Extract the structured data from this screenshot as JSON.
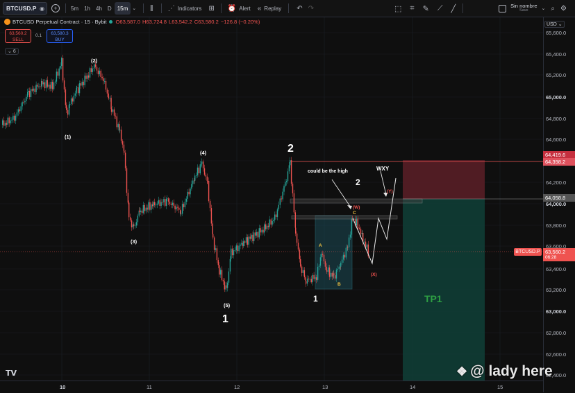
{
  "toolbar": {
    "symbol": "BTCUSD.P",
    "intervals": [
      "5m",
      "1h",
      "4h",
      "D",
      "15m"
    ],
    "active_interval": "15m",
    "indicators_label": "Indicators",
    "alert_label": "Alert",
    "replay_label": "Replay",
    "layout_name": "Sin nombre",
    "layout_status": "Save"
  },
  "legend": {
    "title": "BTCUSD Perpetual Contract · 15 · Bybit",
    "open": "O63,587.0",
    "high": "H63,724.8",
    "low": "L63,542.2",
    "close": "C63,580.2",
    "change": "−126.8 (−0.20%)"
  },
  "trade": {
    "sell_price": "63,560.2",
    "sell_label": "SELL",
    "spread": "0.1",
    "buy_price": "63,580.3",
    "buy_label": "BUY",
    "indicators_count": "6"
  },
  "price_axis": {
    "currency": "USD",
    "labels": [
      "65,600.0",
      "65,400.0",
      "65,200.0",
      "65,000.0",
      "64,800.0",
      "64,600.0",
      "64,200.0",
      "64,000.0",
      "63,800.0",
      "63,600.0",
      "63,400.0",
      "63,200.0",
      "63,000.0",
      "62,800.0",
      "62,600.0",
      "62,400.0"
    ],
    "tag_top": "64,419.6",
    "tag_top2": "64,398.2",
    "tag_mid": "64,058.8",
    "tag_symbol": "BTCUSD.P",
    "tag_last": "63,560.2",
    "tag_countdown": "06:28"
  },
  "time_axis": {
    "labels": [
      "10",
      "11",
      "12",
      "13",
      "14",
      "15"
    ]
  },
  "annotations": {
    "w1": "(1)",
    "w2": "(2)",
    "w3": "(3)",
    "w4": "(4)",
    "w5": "(5)",
    "big1": "1",
    "big2": "2",
    "big2b": "2",
    "big1b": "1",
    "note": "could be the high",
    "wxy": "WXY",
    "W": "(W)",
    "X": "(X)",
    "Y": "(Y)",
    "A": "A",
    "B": "B",
    "C": "C",
    "tp1": "TP1"
  },
  "watermark": "@ lady here",
  "colors": {
    "up": "#26a69a",
    "down": "#ef5350",
    "stop": "#8b2a33",
    "target": "#12463c"
  }
}
